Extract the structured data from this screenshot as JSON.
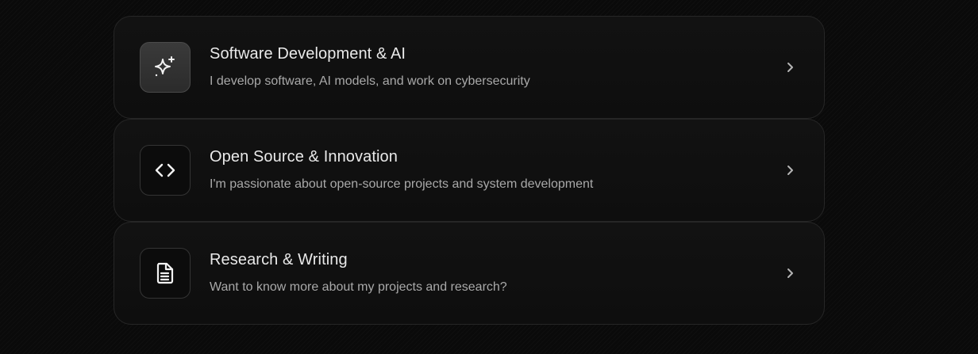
{
  "cards": [
    {
      "title": "Software Development & AI",
      "subtitle": "I develop software, AI models, and work on cybersecurity",
      "icon": "sparkles-icon"
    },
    {
      "title": "Open Source & Innovation",
      "subtitle": "I'm passionate about open-source projects and system development",
      "icon": "code-icon"
    },
    {
      "title": "Research & Writing",
      "subtitle": "Want to know more about my projects and research?",
      "icon": "document-icon"
    }
  ],
  "colors": {
    "background": "#0a0a0a",
    "card": "#121212",
    "border": "#262626",
    "title": "#e9e9e9",
    "subtitle": "#a9a9a9"
  }
}
